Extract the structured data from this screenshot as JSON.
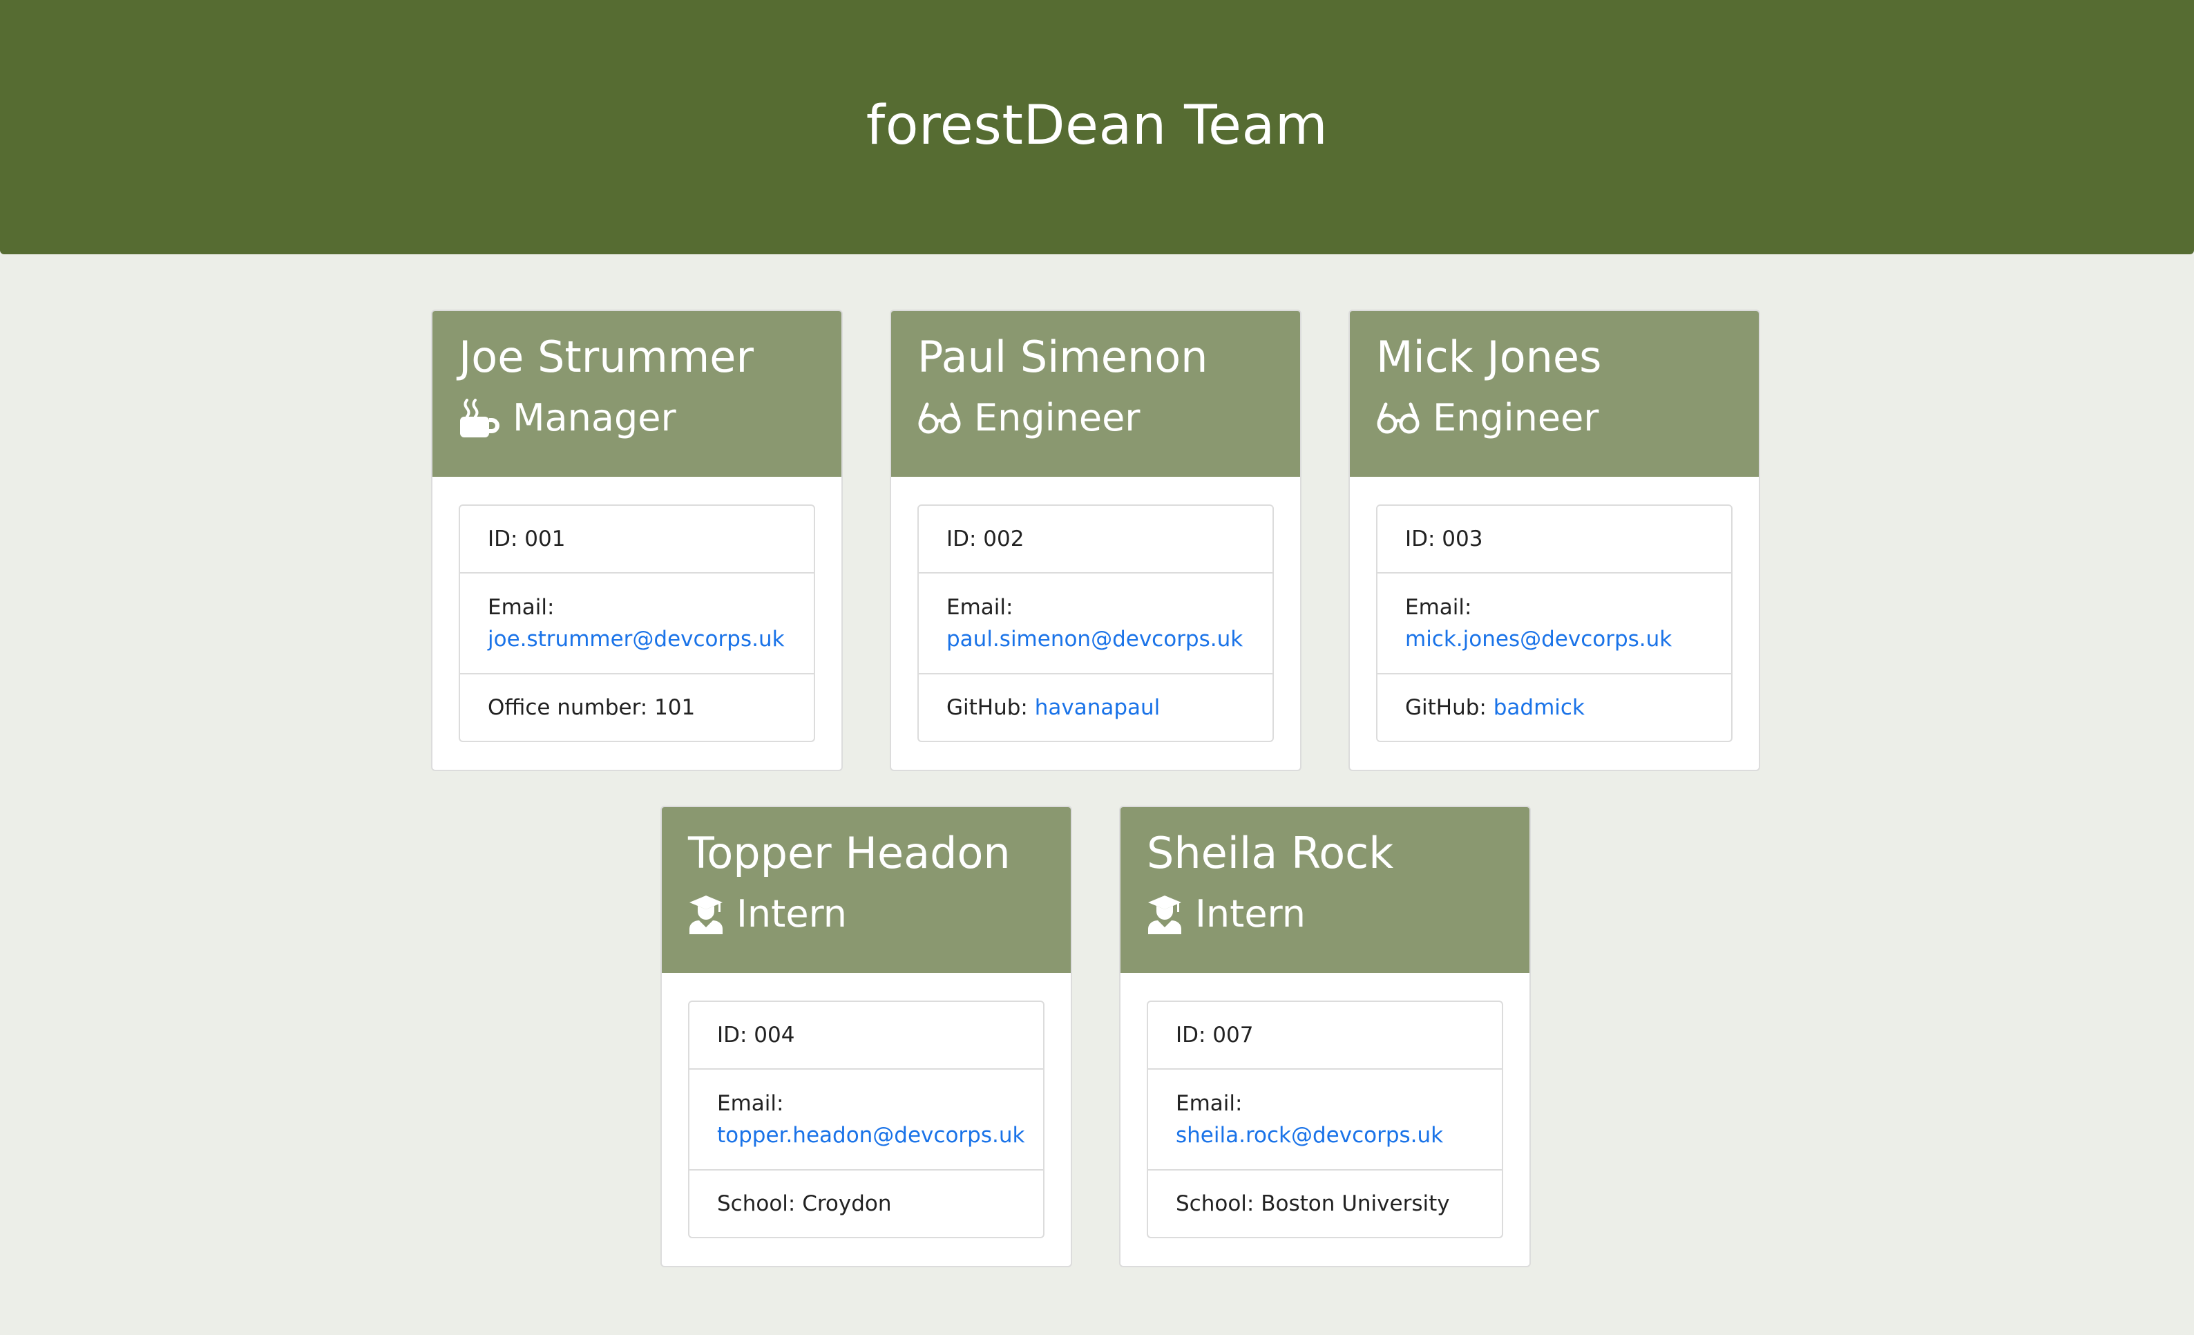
{
  "header": {
    "title": "forestDean Team"
  },
  "employees": [
    {
      "name": "Joe Strummer",
      "role": "Manager",
      "role_icon": "mug-icon",
      "id_label": "ID: 001",
      "email_label": "Email:",
      "email": "joe.strummer@devcorps.uk",
      "extra_label": "Office number: 101",
      "extra_link": ""
    },
    {
      "name": "Paul Simenon",
      "role": "Engineer",
      "role_icon": "glasses-icon",
      "id_label": "ID: 002",
      "email_label": "Email:",
      "email": "paul.simenon@devcorps.uk",
      "extra_label": "GitHub: ",
      "extra_link": "havanapaul"
    },
    {
      "name": "Mick Jones",
      "role": "Engineer",
      "role_icon": "glasses-icon",
      "id_label": "ID: 003",
      "email_label": "Email:",
      "email": "mick.jones@devcorps.uk",
      "extra_label": "GitHub: ",
      "extra_link": "badmick"
    },
    {
      "name": "Topper Headon",
      "role": "Intern",
      "role_icon": "graduate-icon",
      "id_label": "ID: 004",
      "email_label": "Email:",
      "email": "topper.headon@devcorps.uk",
      "extra_label": "School: Croydon",
      "extra_link": ""
    },
    {
      "name": "Sheila Rock",
      "role": "Intern",
      "role_icon": "graduate-icon",
      "id_label": "ID: 007",
      "email_label": "Email:",
      "email": "sheila.rock@devcorps.uk",
      "extra_label": "School: Boston University",
      "extra_link": ""
    }
  ],
  "colors": {
    "header_bg": "#566c32",
    "card_header_bg": "#8a9870",
    "page_bg": "#eceee8",
    "link": "#1a73e8"
  }
}
